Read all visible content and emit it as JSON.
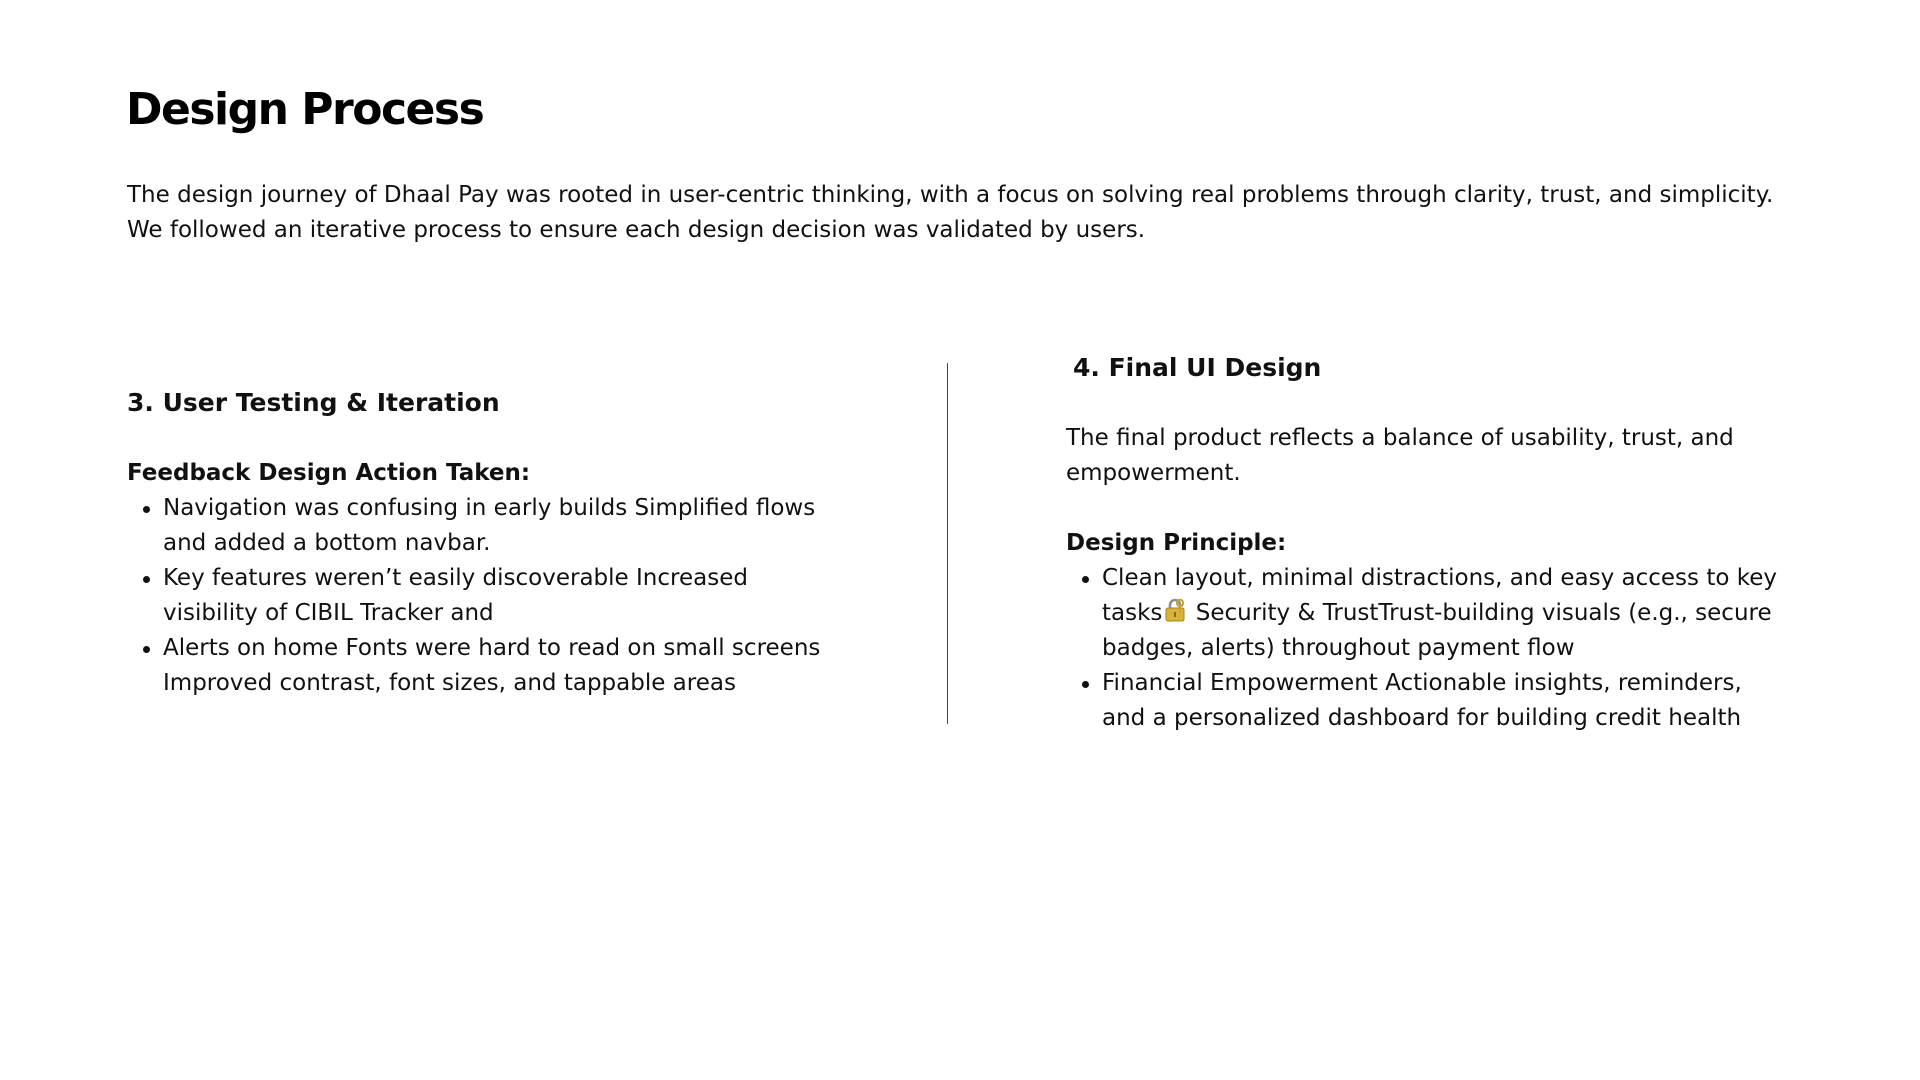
{
  "header": {
    "title": "Design Process",
    "intro": "The design journey of Dhaal Pay was rooted in user-centric thinking, with a focus on solving real problems through clarity, trust, and simplicity. We followed an iterative process to ensure each design decision was validated by users."
  },
  "left_section": {
    "title": "3. User Testing & Iteration",
    "label": "Feedback Design Action Taken:",
    "items": [
      "Navigation was confusing in early builds Simplified flows and added a bottom navbar.",
      "Key features weren’t easily discoverable Increased visibility of CIBIL Tracker and",
      "Alerts on home Fonts were hard to read on small screens Improved contrast, font sizes, and tappable areas"
    ]
  },
  "right_section": {
    "title": "4. Final UI Design",
    "description": "The final product reflects a balance of usability, trust, and empowerment.",
    "label": "Design Principle:",
    "item1_before_icon": "Clean layout, minimal distractions, and easy access to key tasks",
    "item1_icon": "lock-with-key-icon",
    "item1_after_icon": " Security & TrustTrust-building visuals (e.g., secure badges, alerts) throughout payment flow",
    "item2": "Financial Empowerment Actionable insights, reminders, and a personalized dashboard for building credit health"
  }
}
